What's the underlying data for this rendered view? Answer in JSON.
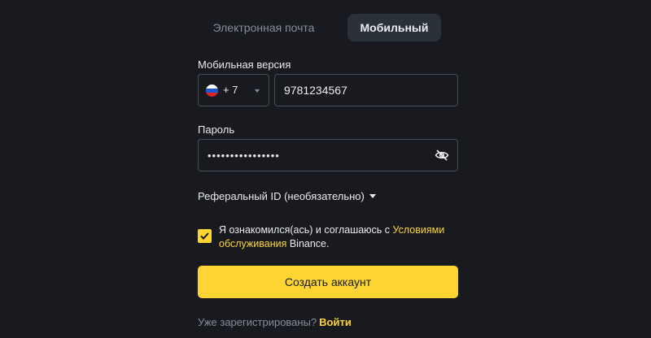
{
  "tabs": {
    "email_label": "Электронная почта",
    "mobile_label": "Мобильный",
    "active": "mobile"
  },
  "mobile": {
    "label": "Мобильная версия",
    "country_flag": "russia-flag",
    "country_code": "+ 7",
    "phone_value": "9781234567"
  },
  "password": {
    "label": "Пароль",
    "masked_value": "••••••••••••••••",
    "visibility_icon": "eye-slash-icon"
  },
  "referral": {
    "label": "Реферальный ID (необязательно)"
  },
  "terms": {
    "checked": true,
    "text_before": "Я ознакомился(ась) и соглашаюсь с ",
    "link_text": "Условиями обслуживания",
    "text_after": " Binance."
  },
  "create_button": {
    "label": "Создать аккаунт"
  },
  "footer": {
    "question": "Уже зарегистрированы?",
    "login_link": "Войти"
  },
  "colors": {
    "background": "#181a20",
    "accent": "#fcd535",
    "input_border": "#474d57",
    "muted_text": "#848e9c",
    "active_tab_bg": "#2b3139"
  }
}
